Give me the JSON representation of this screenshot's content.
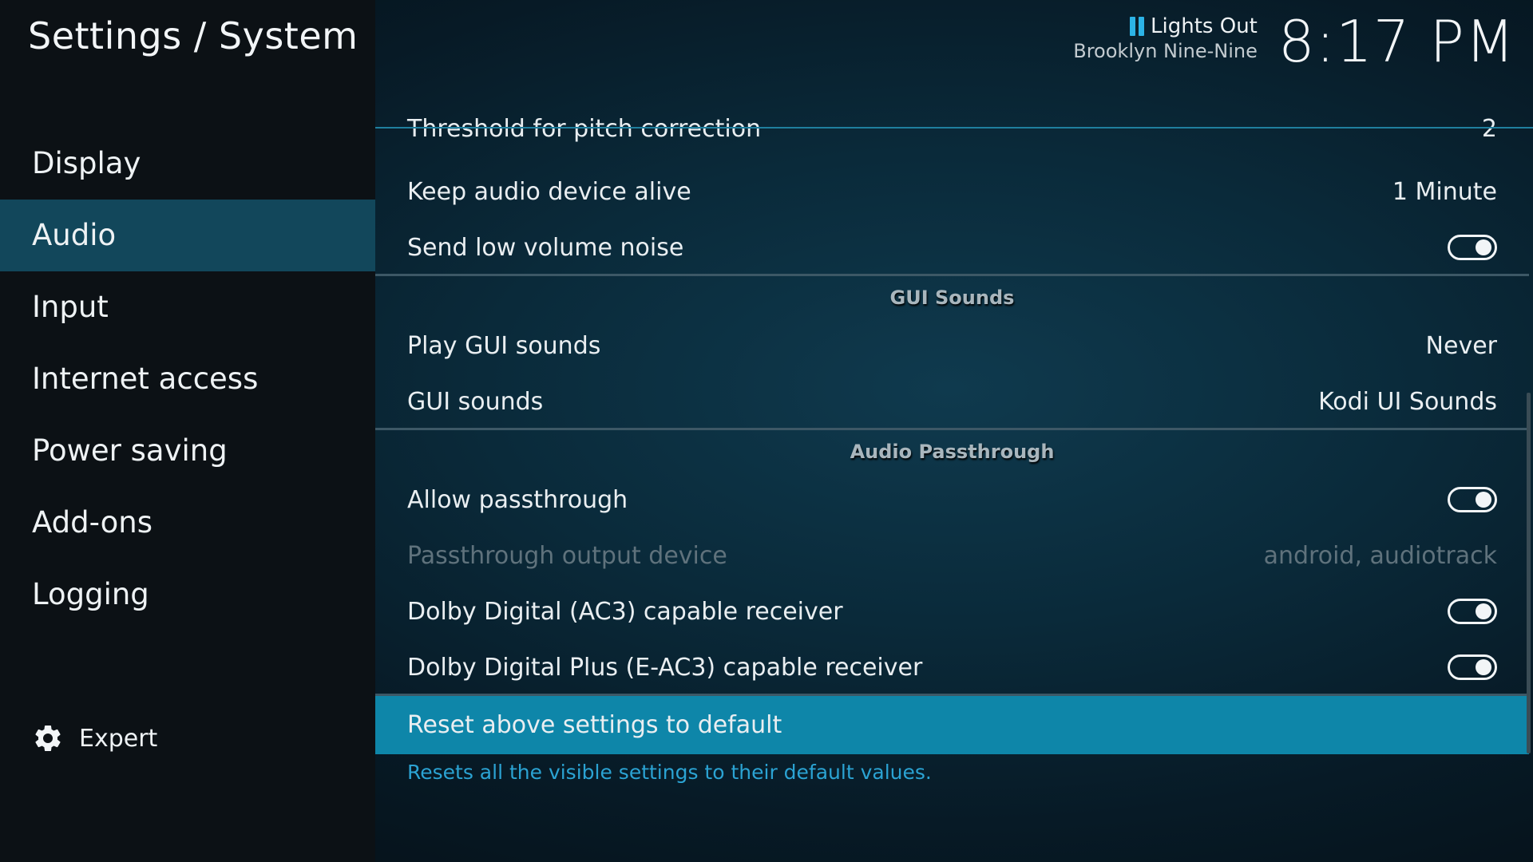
{
  "header": {
    "title": "Settings / System",
    "now_playing": {
      "title": "Lights Out",
      "show": "Brooklyn Nine-Nine",
      "state_icon": "pause-icon"
    },
    "clock": "8:17 PM"
  },
  "sidebar": {
    "items": [
      {
        "label": "Display",
        "active": false
      },
      {
        "label": "Audio",
        "active": true
      },
      {
        "label": "Input",
        "active": false
      },
      {
        "label": "Internet access",
        "active": false
      },
      {
        "label": "Power saving",
        "active": false
      },
      {
        "label": "Add-ons",
        "active": false
      },
      {
        "label": "Logging",
        "active": false
      }
    ],
    "level": {
      "label": "Expert",
      "icon": "gear-icon"
    }
  },
  "settings": {
    "rows": [
      {
        "label": "Threshold for pitch correction",
        "value": "2"
      },
      {
        "label": "Keep audio device alive",
        "value": "1 Minute"
      },
      {
        "label": "Send low volume noise",
        "toggle": true
      },
      {
        "label": "Play GUI sounds",
        "value": "Never"
      },
      {
        "label": "GUI sounds",
        "value": "Kodi UI Sounds"
      },
      {
        "label": "Allow passthrough",
        "toggle": true
      },
      {
        "label": "Passthrough output device",
        "value": "android, audiotrack",
        "disabled": true
      },
      {
        "label": "Dolby Digital (AC3) capable receiver",
        "toggle": true
      },
      {
        "label": "Dolby Digital Plus (E-AC3) capable receiver",
        "toggle": true
      },
      {
        "label": "Reset above settings to default",
        "focused": true
      }
    ],
    "groups": {
      "gui_sounds": "GUI Sounds",
      "passthrough": "Audio Passthrough"
    }
  },
  "description": "Resets all the visible settings to their default values.",
  "colors": {
    "accent": "#0e86a9",
    "sidebar_active": "#12475b",
    "description": "#2ba3d3"
  }
}
